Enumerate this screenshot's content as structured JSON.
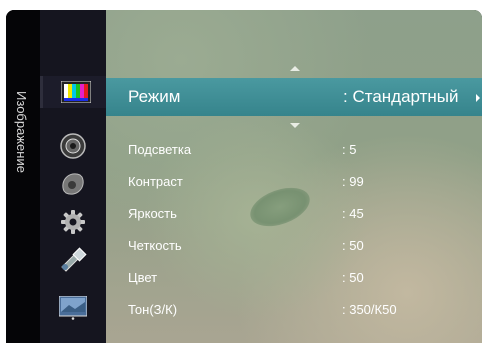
{
  "side_tab": {
    "label": "Изображение"
  },
  "icons": [
    {
      "name": "picture-icon"
    },
    {
      "name": "sound-icon"
    },
    {
      "name": "channel-icon"
    },
    {
      "name": "setup-icon"
    },
    {
      "name": "input-icon"
    },
    {
      "name": "application-icon"
    }
  ],
  "menu": {
    "mode": {
      "label": "Режим",
      "value": ": Стандартный"
    },
    "items": [
      {
        "label": "Подсветка",
        "value": ": 5"
      },
      {
        "label": "Контраст",
        "value": ": 99"
      },
      {
        "label": "Яркость",
        "value": ": 45"
      },
      {
        "label": "Четкость",
        "value": ": 50"
      },
      {
        "label": "Цвет",
        "value": ": 50"
      },
      {
        "label": "Тон(З/К)",
        "value": ": 350/К50"
      }
    ]
  },
  "colors": {
    "highlight": "#3a8a92",
    "sidebar": "#15151f",
    "tab": "#050507"
  }
}
